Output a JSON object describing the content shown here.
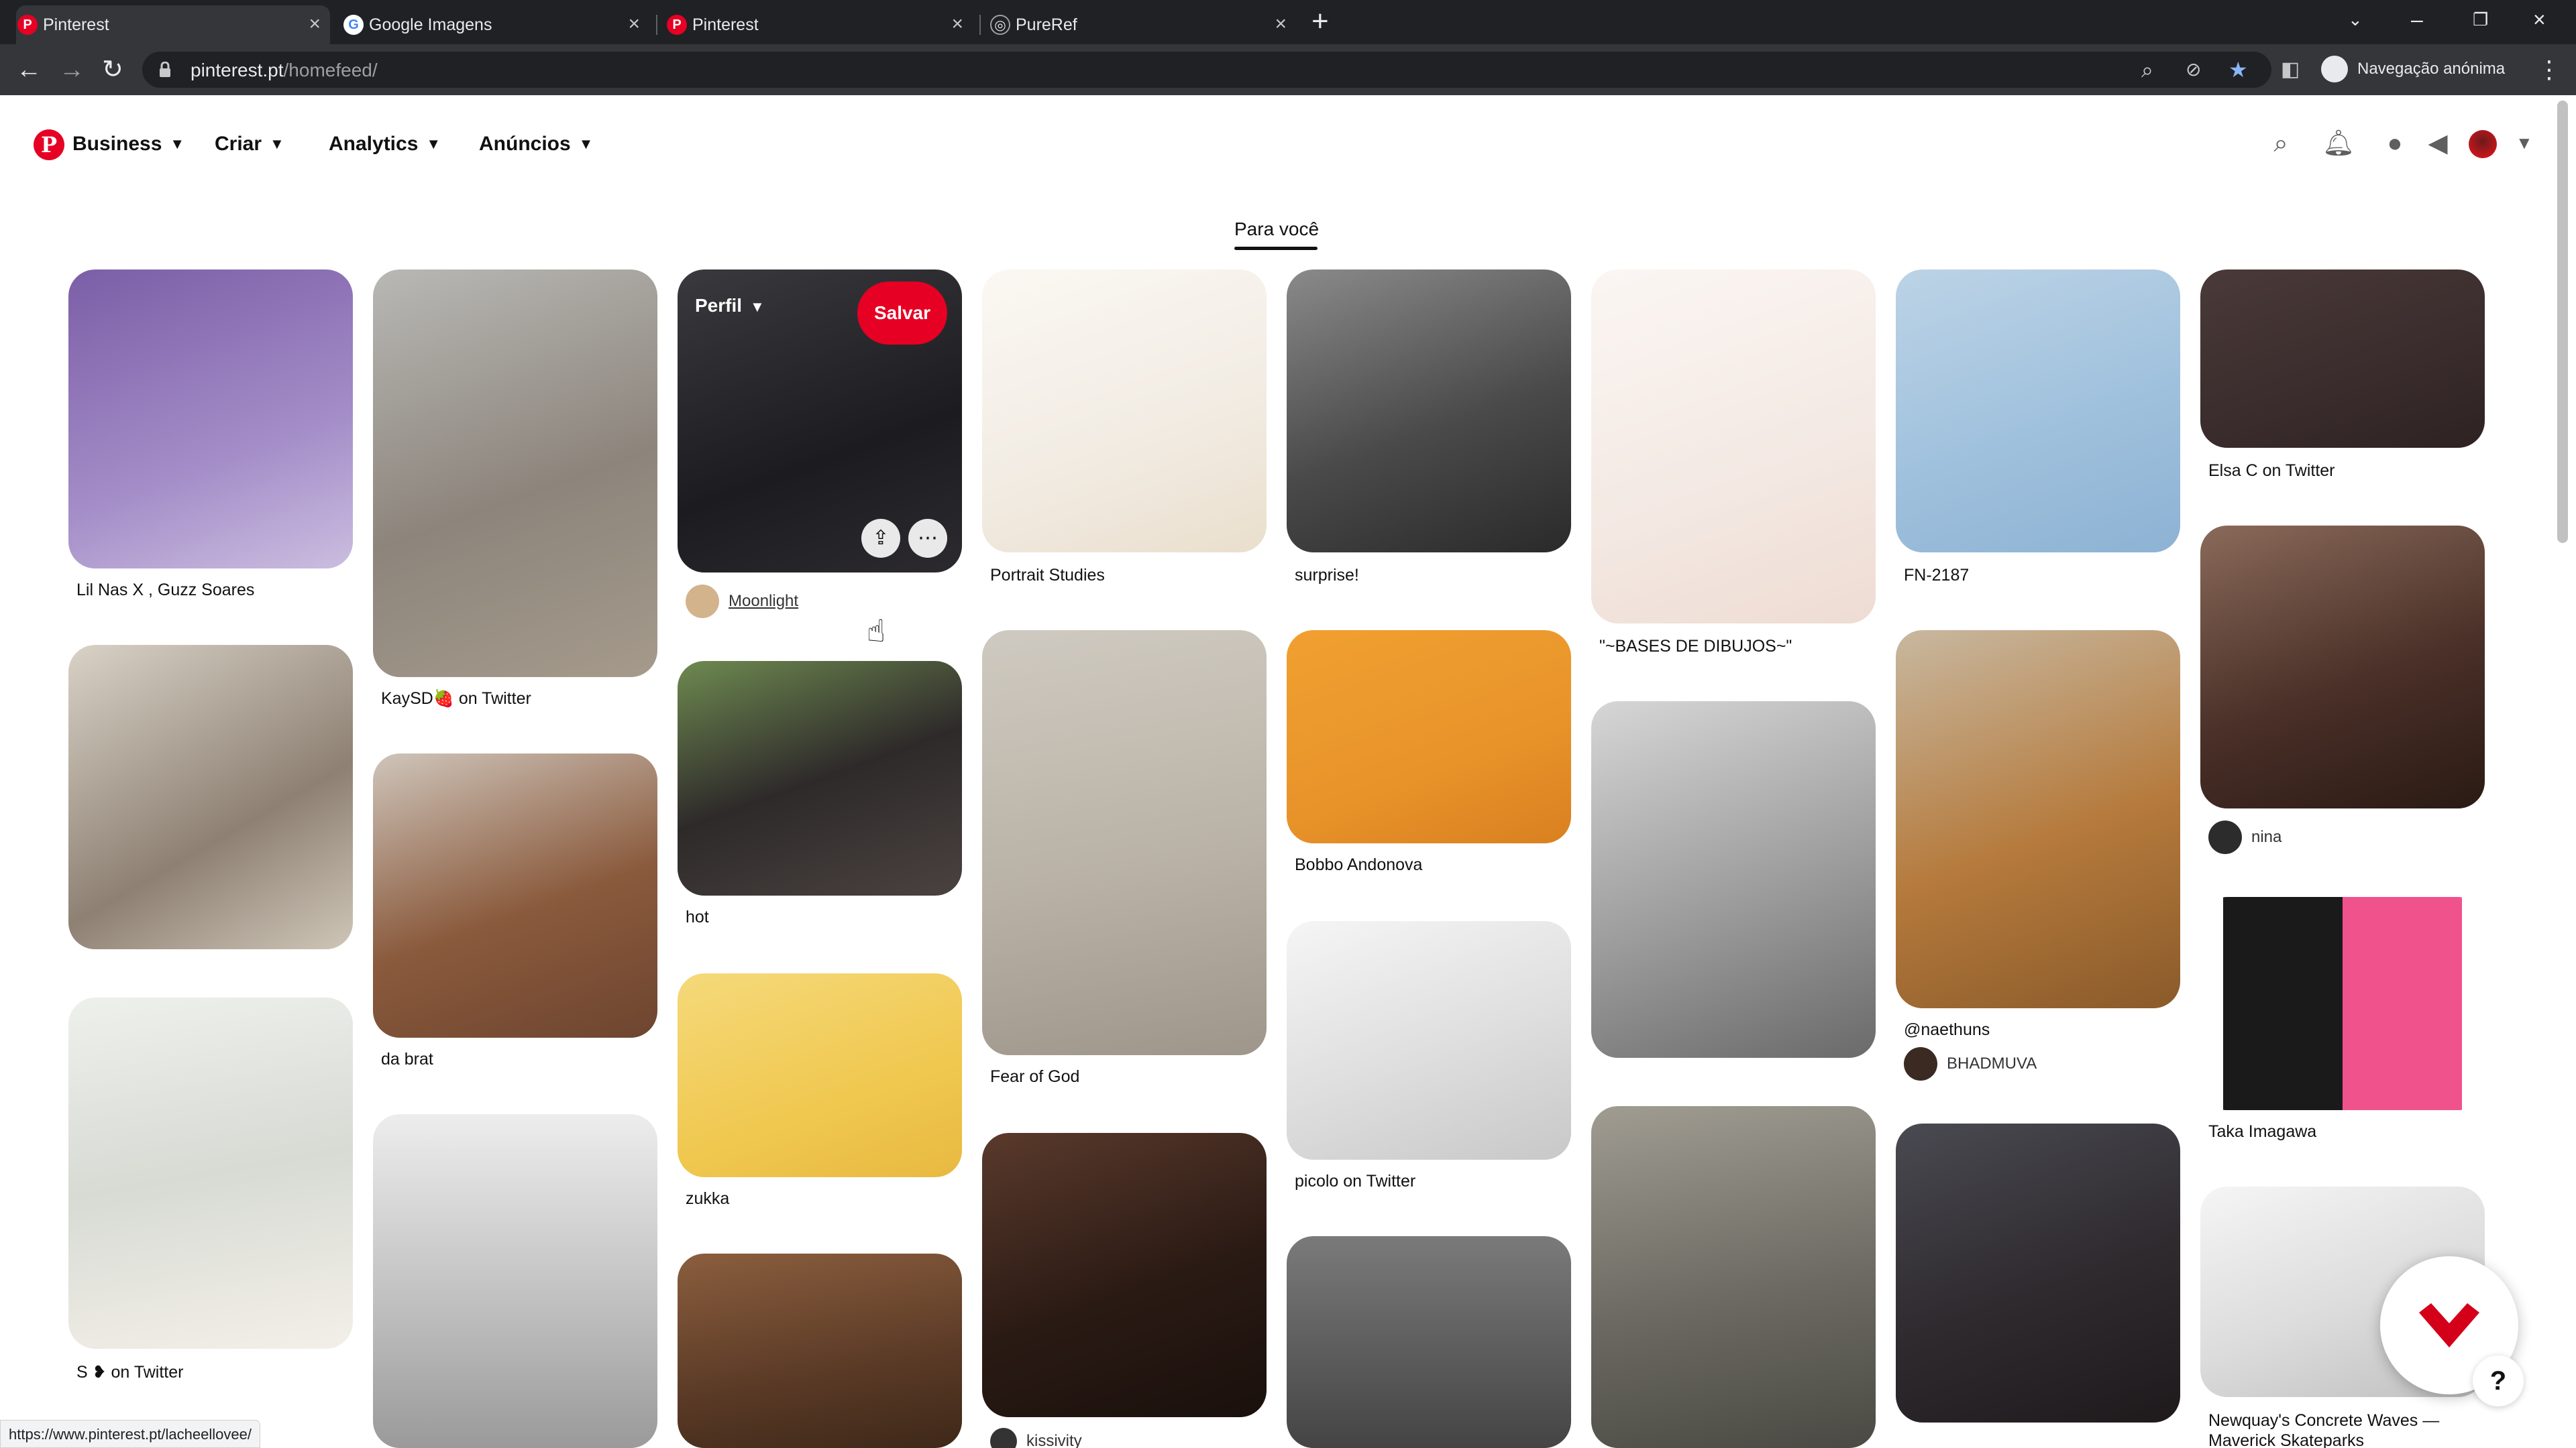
{
  "browser": {
    "tabs": [
      {
        "title": "Pinterest",
        "favicon": "pinterest-icon"
      },
      {
        "title": "Google Imagens",
        "favicon": "google-icon"
      },
      {
        "title": "Pinterest",
        "favicon": "pinterest-icon"
      },
      {
        "title": "PureRef",
        "favicon": "pureref-icon"
      }
    ],
    "url_host": "pinterest.pt",
    "url_path": "/homefeed/",
    "incognito_label": "Navegação anónima",
    "status_url": "https://www.pinterest.pt/lacheellovee/"
  },
  "pinterest": {
    "nav": [
      "Business",
      "Criar",
      "Analytics",
      "Anúncios"
    ],
    "feed_tab": "Para você",
    "hover": {
      "profile_label": "Perfil",
      "save_label": "Salvar"
    },
    "captions": {
      "c1": "Lil Nas X , Guzz Soares",
      "c2": "S ❥ on Twitter",
      "c3": "KaySD🍓 on Twitter",
      "c4": "da brat",
      "c5": "Moonlight",
      "c6": "hot",
      "c7": "zukka",
      "c8": "Portrait Studies",
      "c9": "Fear of God",
      "c10": "kissivity",
      "c11": "surprise!",
      "c12": "Bobbo Andonova",
      "c13": "picolo on Twitter",
      "c14": "\"~BASES DE DIBUJOS~\"",
      "c15": "FN-2187",
      "c16": "@naethuns",
      "c17": "BHADMUVA",
      "c18": "Elsa C on Twitter",
      "c19": "nina",
      "c20": "Taka Imagawa",
      "c21": "Newquay's Concrete Waves — Maverick Skateparks"
    }
  },
  "colors": {
    "brand": "#e60023",
    "chrome_dark": "#202124",
    "chrome_tab": "#35363a"
  }
}
